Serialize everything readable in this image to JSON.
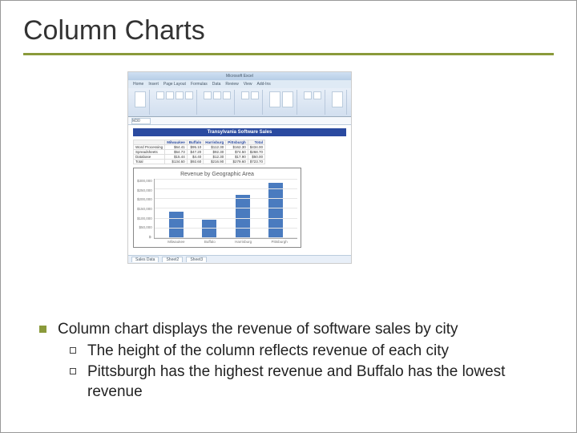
{
  "title": "Column Charts",
  "excel": {
    "window_title": "Microsoft Excel",
    "tabs": [
      "Home",
      "Insert",
      "Page Layout",
      "Formulas",
      "Data",
      "Review",
      "View",
      "Add-Ins"
    ],
    "name_box": "M30",
    "table_title": "Transylvania Software Sales",
    "columns": [
      "",
      "Milwaukee",
      "Buffalo",
      "Harrisburg",
      "Pittsburgh",
      "Total"
    ],
    "rows": [
      [
        "Word Processing",
        "$64.41",
        "$95.10",
        "$112.30",
        "$162.30",
        "$434.00"
      ],
      [
        "Spreadsheets",
        "$54.73",
        "$47.20",
        "$92.30",
        "$74.50",
        "$268.70"
      ],
      [
        "Database",
        "$15.44",
        "$4.40",
        "$12.30",
        "$17.90",
        "$50.00"
      ],
      [
        "Total",
        "$134.60",
        "$92.60",
        "$216.90",
        "$279.60",
        "$723.70"
      ]
    ],
    "sheet_tabs": [
      "Sales Data",
      "Sheet2",
      "Sheet3"
    ]
  },
  "chart_data": {
    "type": "bar",
    "title": "Revenue by Geographic Area",
    "categories": [
      "Milwaukee",
      "Buffalo",
      "Harrisburg",
      "Pittsburgh"
    ],
    "values": [
      135000,
      93000,
      217000,
      280000
    ],
    "ylabel": "",
    "xlabel": "",
    "ylim": [
      0,
      300000
    ],
    "yticks": [
      "$300,000",
      "$250,000",
      "$200,000",
      "$150,000",
      "$100,000",
      "$50,000",
      "$-"
    ]
  },
  "bullets": {
    "main": "Column chart displays the revenue of software sales by city",
    "sub1": "The height of the column reflects revenue of each city",
    "sub2": "Pittsburgh has the highest revenue and Buffalo has the lowest    revenue"
  }
}
